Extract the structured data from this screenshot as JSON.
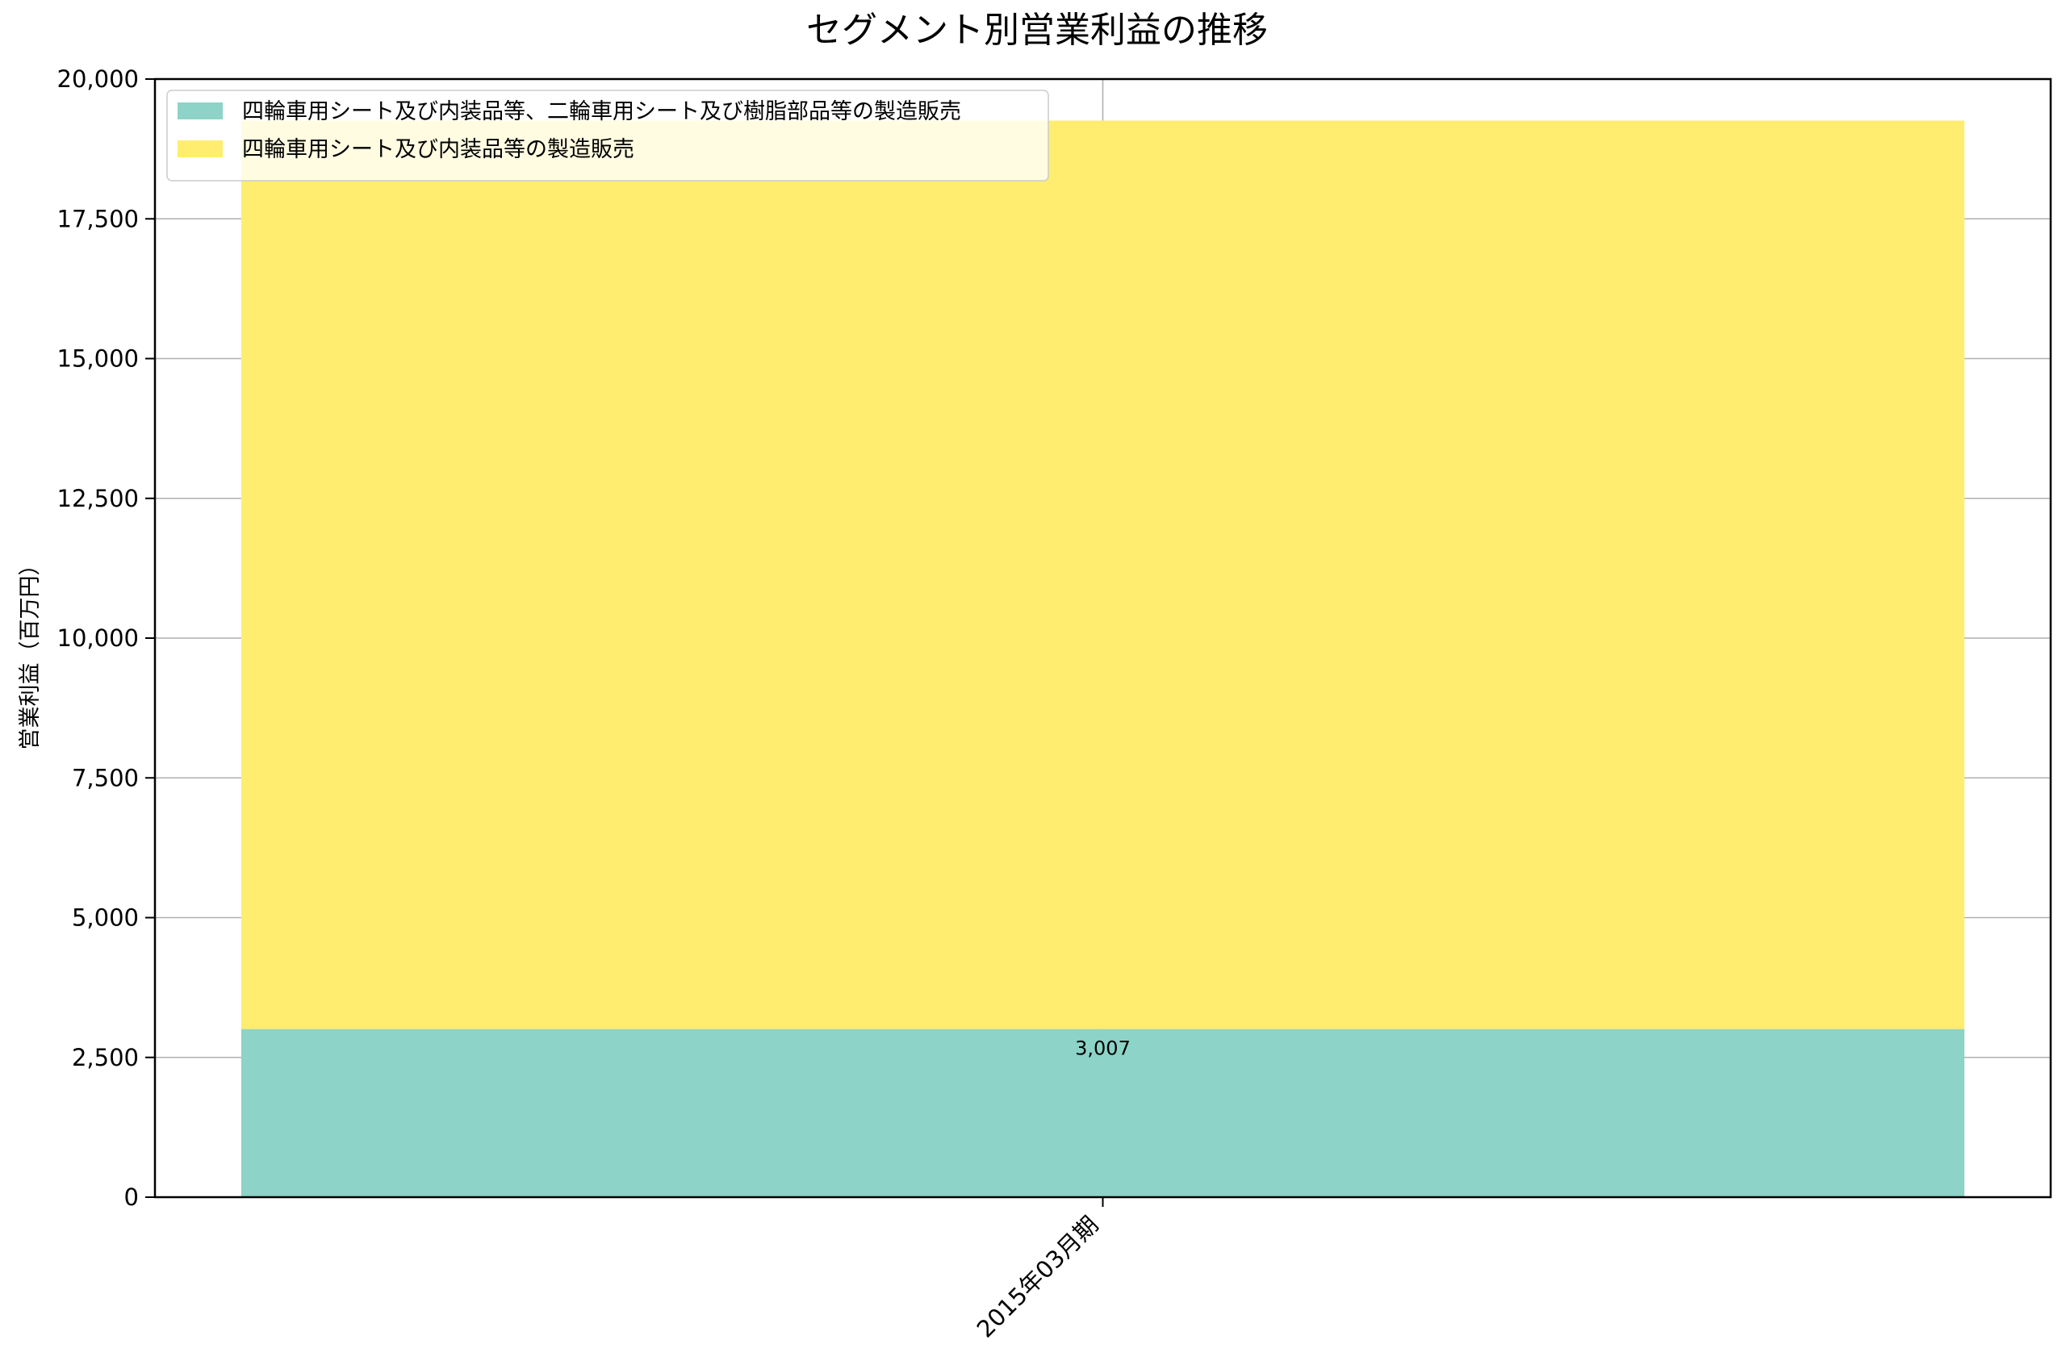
{
  "chart_data": {
    "type": "bar",
    "stacked": true,
    "title": "セグメント別営業利益の推移",
    "xlabel": "",
    "ylabel": "営業利益（百万円）",
    "categories": [
      "2015年03月期"
    ],
    "ylim": [
      0,
      20000
    ],
    "yticks": [
      0,
      2500,
      5000,
      7500,
      10000,
      12500,
      15000,
      17500,
      20000
    ],
    "ytick_labels": [
      "0",
      "2,500",
      "5,000",
      "7,500",
      "10,000",
      "12,500",
      "15,000",
      "17,500",
      "20,000"
    ],
    "grid": true,
    "legend_position": "top-left",
    "series": [
      {
        "name": "四輪車用シート及び内装品等、二輪車用シート及び樹脂部品等の製造販売",
        "values": [
          3007
        ],
        "color": "#8dd3c7",
        "data_labels": [
          "3,007"
        ]
      },
      {
        "name": "四輪車用シート及び内装品等の製造販売",
        "values": [
          16250
        ],
        "color": "#ffed6f",
        "data_labels": [
          ""
        ]
      }
    ]
  }
}
